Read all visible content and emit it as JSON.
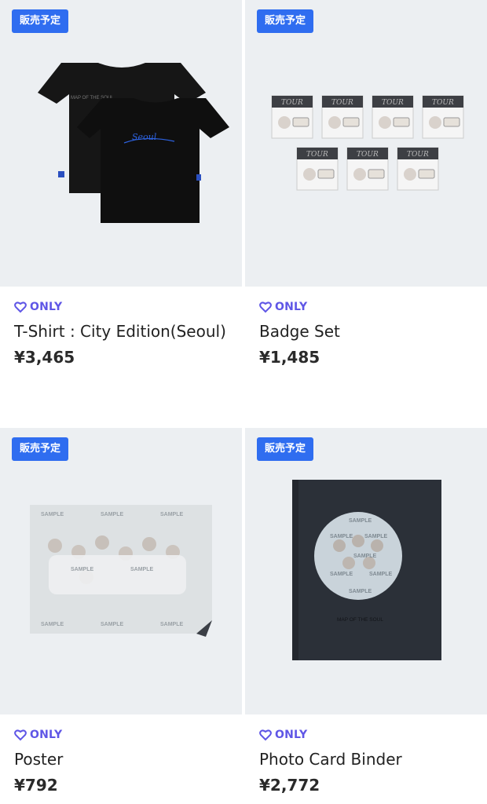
{
  "products": [
    {
      "badge": "販売予定",
      "only": "ONLY",
      "name": "T-Shirt : City Edition(Seoul)",
      "price": "¥3,465"
    },
    {
      "badge": "販売予定",
      "only": "ONLY",
      "name": "Badge Set",
      "price": "¥1,485"
    },
    {
      "badge": "販売予定",
      "only": "ONLY",
      "name": "Poster",
      "price": "¥792"
    },
    {
      "badge": "販売予定",
      "only": "ONLY",
      "name": "Photo Card Binder",
      "price": "¥2,772"
    }
  ],
  "colors": {
    "badge": "#2f6df0",
    "only": "#5f56e6",
    "image_bg": "#eceff2"
  },
  "images": {
    "tshirt": {
      "print": "MAP OF THE SOUL"
    },
    "badges": {
      "header": "TOUR"
    },
    "poster": {
      "watermark": "SAMPLE"
    },
    "binder": {
      "cover_text": "MAP OF THE SOUL",
      "watermark": "SAMPLE"
    }
  }
}
